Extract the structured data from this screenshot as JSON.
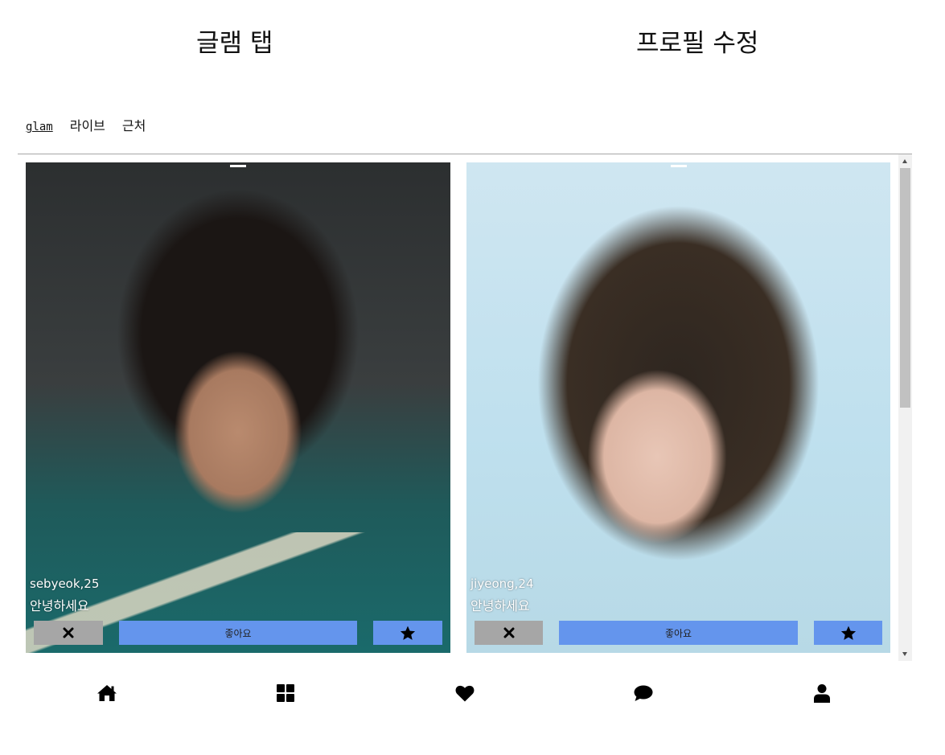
{
  "header": {
    "left_title": "글램 탭",
    "right_title": "프로필 수정"
  },
  "tabs": [
    {
      "label": "glam"
    },
    {
      "label": "라이브"
    },
    {
      "label": "근처"
    }
  ],
  "cards": [
    {
      "name_age": "sebyeok,25",
      "greeting": "안녕하세요",
      "like_label": "좋아요",
      "reject_icon": "close-icon",
      "star_icon": "star-icon"
    },
    {
      "name_age": "jiyeong,24",
      "greeting": "안녕하세요",
      "like_label": "좋아요",
      "reject_icon": "close-icon",
      "star_icon": "star-icon"
    }
  ],
  "bottom_nav": [
    {
      "icon": "home-icon"
    },
    {
      "icon": "grid-icon"
    },
    {
      "icon": "heart-icon"
    },
    {
      "icon": "chat-icon"
    },
    {
      "icon": "user-icon"
    }
  ],
  "colors": {
    "like_button": "#6495ed",
    "star_button": "#6495ed",
    "reject_button": "#a6a6a6",
    "divider": "#a6a6a6",
    "text": "#111111"
  }
}
